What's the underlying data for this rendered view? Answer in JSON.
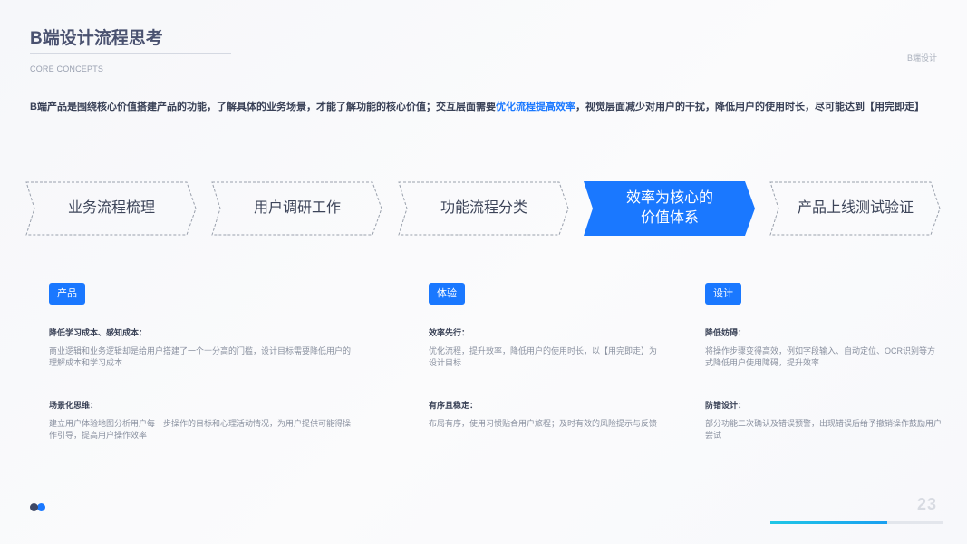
{
  "header": {
    "title": "B端设计流程思考",
    "subtitle": "CORE CONCEPTS",
    "tag": "B端设计"
  },
  "intro": {
    "before": "B端产品是围绕核心价值搭建产品的功能，了解具体的业务场景，才能了解功能的核心价值；交互层面需要",
    "highlight": "优化流程提高效率",
    "after": "，视觉层面减少对用户的干扰，降低用户的使用时长，尽可能达到【用完即走】"
  },
  "steps": [
    {
      "line1": "业务流程梳理",
      "line2": ""
    },
    {
      "line1": "用户调研工作",
      "line2": ""
    },
    {
      "line1": "功能流程分类",
      "line2": ""
    },
    {
      "line1": "效率为核心的",
      "line2": "价值体系"
    },
    {
      "line1": "产品上线测试验证",
      "line2": ""
    }
  ],
  "columns": [
    {
      "badge": "产品",
      "items": [
        {
          "title": "降低学习成本、感知成本：",
          "desc": "商业逻辑和业务逻辑却是给用户搭建了一个十分高的门槛，设计目标需要降低用户的理解成本和学习成本"
        },
        {
          "title": "场景化思维：",
          "desc": "建立用户体验地图分析用户每一步操作的目标和心理活动情况，为用户提供可能得操作引导，提高用户操作效率"
        }
      ]
    },
    {
      "badge": "体验",
      "items": [
        {
          "title": "效率先行：",
          "desc": "优化流程，提升效率，降低用户的使用时长，以【用完即走】为设计目标"
        },
        {
          "title": "有序且稳定：",
          "desc": "布局有序，使用习惯贴合用户旅程；及时有效的风险提示与反馈"
        }
      ]
    },
    {
      "badge": "设计",
      "items": [
        {
          "title": "降低妨碍：",
          "desc": "将操作步骤变得高效，例如字段输入、自动定位、OCR识别等方式降低用户使用障碍，提升效率"
        },
        {
          "title": "防错设计：",
          "desc": "部分功能二次确认及错误预警，出现错误后给予撤销操作鼓励用户尝试"
        }
      ]
    }
  ],
  "footer": {
    "page_number": "23",
    "progress": 0.68
  },
  "colors": {
    "accent": "#1a78ff",
    "dark": "#3d4766",
    "progress": "#1fc7e6"
  }
}
